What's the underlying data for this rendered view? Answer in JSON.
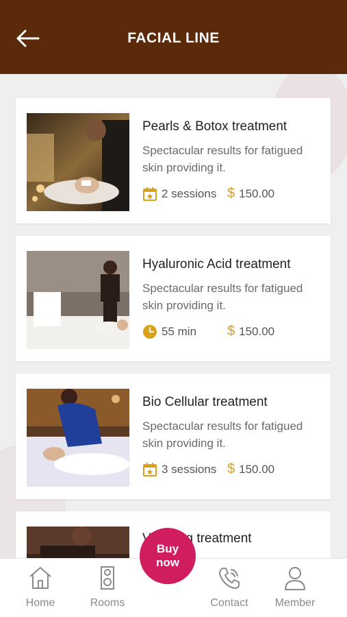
{
  "header": {
    "title": "FACIAL LINE"
  },
  "treatments": [
    {
      "title": "Pearls & Botox treatment",
      "description": "Spectacular results for fatigued skin providing it.",
      "meta_icon": "calendar-star-icon",
      "meta": "2 sessions",
      "currency": "$",
      "price": "150.00"
    },
    {
      "title": "Hyaluronic Acid treatment",
      "description": "Spectacular results for fatigued skin providing it.",
      "meta_icon": "clock-icon",
      "meta": "55 min",
      "currency": "$",
      "price": "150.00"
    },
    {
      "title": "Bio Cellular treatment",
      "description": "Spectacular results for fatigued skin providing it.",
      "meta_icon": "calendar-star-icon",
      "meta": "3 sessions",
      "currency": "$",
      "price": "150.00"
    },
    {
      "title_visible_left": "V",
      "title_visible_right": "ing treatment"
    }
  ],
  "buy_button": {
    "line1": "Buy",
    "line2": "now"
  },
  "nav": {
    "items": [
      {
        "label": "Home",
        "icon": "home-icon"
      },
      {
        "label": "Rooms",
        "icon": "door-hanger-icon"
      },
      {
        "label": "Contact",
        "icon": "phone-icon"
      },
      {
        "label": "Member",
        "icon": "person-icon"
      }
    ]
  },
  "colors": {
    "header": "#5a2a0b",
    "accent": "#d9a21b",
    "buy": "#cf1d5f"
  }
}
